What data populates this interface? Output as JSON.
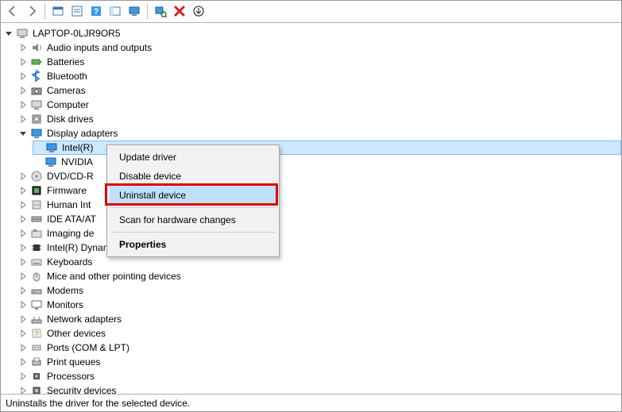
{
  "toolbar": {
    "back": "back-arrow",
    "forward": "forward-arrow",
    "view": "view",
    "properties": "properties-sheet",
    "help": "help",
    "show_hidden": "show-hidden",
    "computer": "remote-computer",
    "add_legacy": "add-legacy",
    "remove": "remove",
    "scan": "scan-hardware"
  },
  "tree": {
    "root": {
      "label": "LAPTOP-0LJR9OR5",
      "icon": "computer",
      "expanded": true
    },
    "children": [
      {
        "label": "Audio inputs and outputs",
        "icon": "audio",
        "expanded": false
      },
      {
        "label": "Batteries",
        "icon": "battery",
        "expanded": false
      },
      {
        "label": "Bluetooth",
        "icon": "bluetooth",
        "expanded": false
      },
      {
        "label": "Cameras",
        "icon": "camera",
        "expanded": false
      },
      {
        "label": "Computer",
        "icon": "computer",
        "expanded": false
      },
      {
        "label": "Disk drives",
        "icon": "disk",
        "expanded": false
      },
      {
        "label": "Display adapters",
        "icon": "display",
        "expanded": true,
        "children": [
          {
            "label": "Intel(R)",
            "icon": "display",
            "selected": true
          },
          {
            "label": "NVIDIA",
            "icon": "display"
          }
        ]
      },
      {
        "label": "DVD/CD-R",
        "icon": "dvd",
        "expanded": false
      },
      {
        "label": "Firmware",
        "icon": "firmware",
        "expanded": false
      },
      {
        "label": "Human Int",
        "icon": "hid",
        "expanded": false
      },
      {
        "label": "IDE ATA/AT",
        "icon": "ide",
        "expanded": false
      },
      {
        "label": "Imaging de",
        "icon": "imaging",
        "expanded": false
      },
      {
        "label": "Intel(R) Dynamic Platform and Thermal Framework",
        "icon": "chip",
        "expanded": false
      },
      {
        "label": "Keyboards",
        "icon": "keyboard",
        "expanded": false
      },
      {
        "label": "Mice and other pointing devices",
        "icon": "mouse",
        "expanded": false
      },
      {
        "label": "Modems",
        "icon": "modem",
        "expanded": false
      },
      {
        "label": "Monitors",
        "icon": "monitor",
        "expanded": false
      },
      {
        "label": "Network adapters",
        "icon": "network",
        "expanded": false
      },
      {
        "label": "Other devices",
        "icon": "other",
        "expanded": false
      },
      {
        "label": "Ports (COM & LPT)",
        "icon": "ports",
        "expanded": false
      },
      {
        "label": "Print queues",
        "icon": "printer",
        "expanded": false
      },
      {
        "label": "Processors",
        "icon": "cpu",
        "expanded": false
      },
      {
        "label": "Security devices",
        "icon": "security",
        "expanded": false
      }
    ]
  },
  "context_menu": {
    "items": [
      {
        "label": "Update driver"
      },
      {
        "label": "Disable device"
      },
      {
        "label": "Uninstall device",
        "hover": true,
        "highlighted": true
      },
      {
        "sep": true
      },
      {
        "label": "Scan for hardware changes"
      },
      {
        "sep": true
      },
      {
        "label": "Properties",
        "bold": true
      }
    ]
  },
  "statusbar": {
    "text": "Uninstalls the driver for the selected device."
  }
}
